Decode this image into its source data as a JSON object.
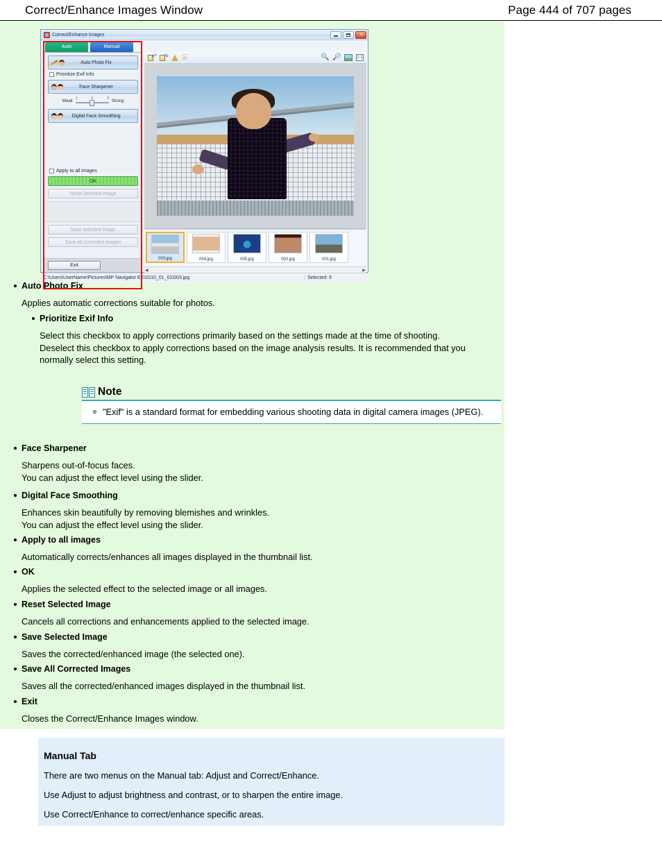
{
  "header": {
    "title": "Correct/Enhance Images Window",
    "page_label": "Page 444 of 707 pages"
  },
  "app_window": {
    "title": "Correct/Enhance Images",
    "window_buttons": {
      "minimize": "minimize-button",
      "maximize": "maximize-button",
      "close": "close-button"
    },
    "tabs": [
      {
        "label": "Auto",
        "active": true
      },
      {
        "label": "Manual",
        "active": false
      }
    ],
    "toolbar_icons": [
      "rotate-left-icon",
      "rotate-right-icon",
      "mirror-icon",
      "crop-icon",
      "zoom-in-icon",
      "zoom-out-icon",
      "fit-to-window-icon",
      "actual-size-icon"
    ],
    "panel": {
      "auto_photo_fix": "Auto Photo Fix",
      "prioritize_exif": "Prioritize Exif Info",
      "face_sharpener": "Face Sharpener",
      "slider": {
        "weak": "Weak",
        "strong": "Strong",
        "ticks": [
          "1",
          "2",
          "3"
        ],
        "value": 2
      },
      "digital_face_smoothing": "Digital Face Smoothing",
      "apply_all": "Apply to all images",
      "ok": "OK",
      "reset_selected": "Reset Selected Image",
      "save_selected": "Save Selected Image",
      "save_all": "Save All Corrected Images",
      "exit": "Exit"
    },
    "thumbnails": [
      {
        "name": "003.jpg",
        "selected": true
      },
      {
        "name": "004.jpg",
        "selected": false
      },
      {
        "name": "005.jpg",
        "selected": false
      },
      {
        "name": "002.jpg",
        "selected": false
      },
      {
        "name": "001.jpg",
        "selected": false
      }
    ],
    "statusbar": {
      "path": "C:\\Users\\UserName\\Pictures\\MP Navigator EX\\2010_01_01\\003.jpg",
      "selected": "Selected: 5"
    }
  },
  "sections": {
    "auto_photo_fix": {
      "heading": "Auto Photo Fix",
      "body": "Applies automatic corrections suitable for photos."
    },
    "prioritize_exif": {
      "heading": "Prioritize Exif Info",
      "body_1": "Select this checkbox to apply corrections primarily based on the settings made at the time of shooting.",
      "body_2": "Deselect this checkbox to apply corrections based on the image analysis results. It is recommended that you normally select this setting."
    },
    "note": {
      "title": "Note",
      "item": "\"Exif\" is a standard format for embedding various shooting data in digital camera images (JPEG)."
    },
    "face_sharpener": {
      "heading": "Face Sharpener",
      "body_1": "Sharpens out-of-focus faces.",
      "body_2": "You can adjust the effect level using the slider."
    },
    "digital_face_smoothing": {
      "heading": "Digital Face Smoothing",
      "body_1": "Enhances skin beautifully by removing blemishes and wrinkles.",
      "body_2": "You can adjust the effect level using the slider."
    },
    "apply_all": {
      "heading": "Apply to all images",
      "body": "Automatically corrects/enhances all images displayed in the thumbnail list."
    },
    "ok": {
      "heading": "OK",
      "body": "Applies the selected effect to the selected image or all images."
    },
    "reset_selected": {
      "heading": "Reset Selected Image",
      "body": "Cancels all corrections and enhancements applied to the selected image."
    },
    "save_selected": {
      "heading": "Save Selected Image",
      "body": "Saves the corrected/enhanced image (the selected one)."
    },
    "save_all": {
      "heading": "Save All Corrected Images",
      "body": "Saves all the corrected/enhanced images displayed in the thumbnail list."
    },
    "exit": {
      "heading": "Exit",
      "body": "Closes the Correct/Enhance Images window."
    },
    "manual_tab": {
      "heading": "Manual Tab",
      "p1": "There are two menus on the Manual tab: Adjust and Correct/Enhance.",
      "p2": "Use Adjust to adjust brightness and contrast, or to sharpen the entire image.",
      "p3": "Use Correct/Enhance to correct/enhance specific areas."
    }
  },
  "colors": {
    "green_section": "#e4fade",
    "blue_section": "#e3eefb",
    "note_accent": "#3aa6ad",
    "auto_tab": "#0c9e63",
    "manual_tab": "#1d63bd",
    "annotation_red": "#e8100f",
    "ok_green": "#6fd45c"
  }
}
